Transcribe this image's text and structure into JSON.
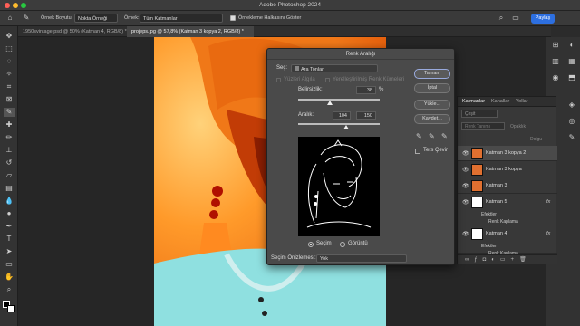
{
  "app": {
    "title": "Adobe Photoshop 2024"
  },
  "options_bar": {
    "sample_size_label": "Örnek Boyutu:",
    "sample_size_value": "Nokta Örneği",
    "sample_label": "Örnek:",
    "sample_value": "Tüm Katmanlar",
    "show_ring_label": "Örnekleme Halkasını Göster",
    "share_label": "Paylaş"
  },
  "doc_tabs": [
    {
      "label": "1950svintage.psd @ 50% (Katman 4, RGB/8) *"
    },
    {
      "label": "projeps.jpg @ 57,8% (Katman 3 kopya 2, RGB/8) *"
    }
  ],
  "dialog": {
    "title": "Renk Aralığı",
    "select_label": "Seç:",
    "select_value": "Ara Tonlar",
    "detect_faces_label": "Yüzleri Algıla",
    "localized_label": "Yerelleştirilmiş Renk Kümeleri",
    "fuzziness_label": "Belirsizlik:",
    "fuzziness_value": "38",
    "fuzziness_unit": "%",
    "range_label": "Aralık:",
    "range_low": "104",
    "range_high": "150",
    "selection_radio": "Seçim",
    "image_radio": "Görüntü",
    "preview_label": "Seçim Önizlemesi:",
    "preview_value": "Yok",
    "invert_label": "Ters Çevir",
    "ok_button": "Tamam",
    "cancel_button": "İptal",
    "load_button": "Yükle...",
    "save_button": "Kaydet..."
  },
  "layers_panel": {
    "tabs": [
      "Katmanlar",
      "Kanallar",
      "Yollar"
    ],
    "search_placeholder": "Çeşit",
    "blend_mode": "Renk Tanımı",
    "opacity_label": "Opaklık",
    "fill_label": "Dolgu",
    "layers": [
      {
        "name": "Katman 3 kopya 2",
        "selected": true
      },
      {
        "name": "Katman 3 kopya",
        "selected": false
      },
      {
        "name": "Katman 3",
        "selected": false
      },
      {
        "name": "Katman 5",
        "selected": false,
        "effects_label": "Efektler",
        "effect": "Renk Kaplama"
      },
      {
        "name": "Katman 4",
        "selected": false,
        "effects_label": "Efektler",
        "effect": "Renk Kaplama"
      }
    ]
  },
  "colors": {
    "accent": "#2d6fe0",
    "dialog_bg": "#4a4a4a",
    "panel_bg": "#383838",
    "image_orange": "#f07a14",
    "image_cyan": "#8fe0e0"
  }
}
